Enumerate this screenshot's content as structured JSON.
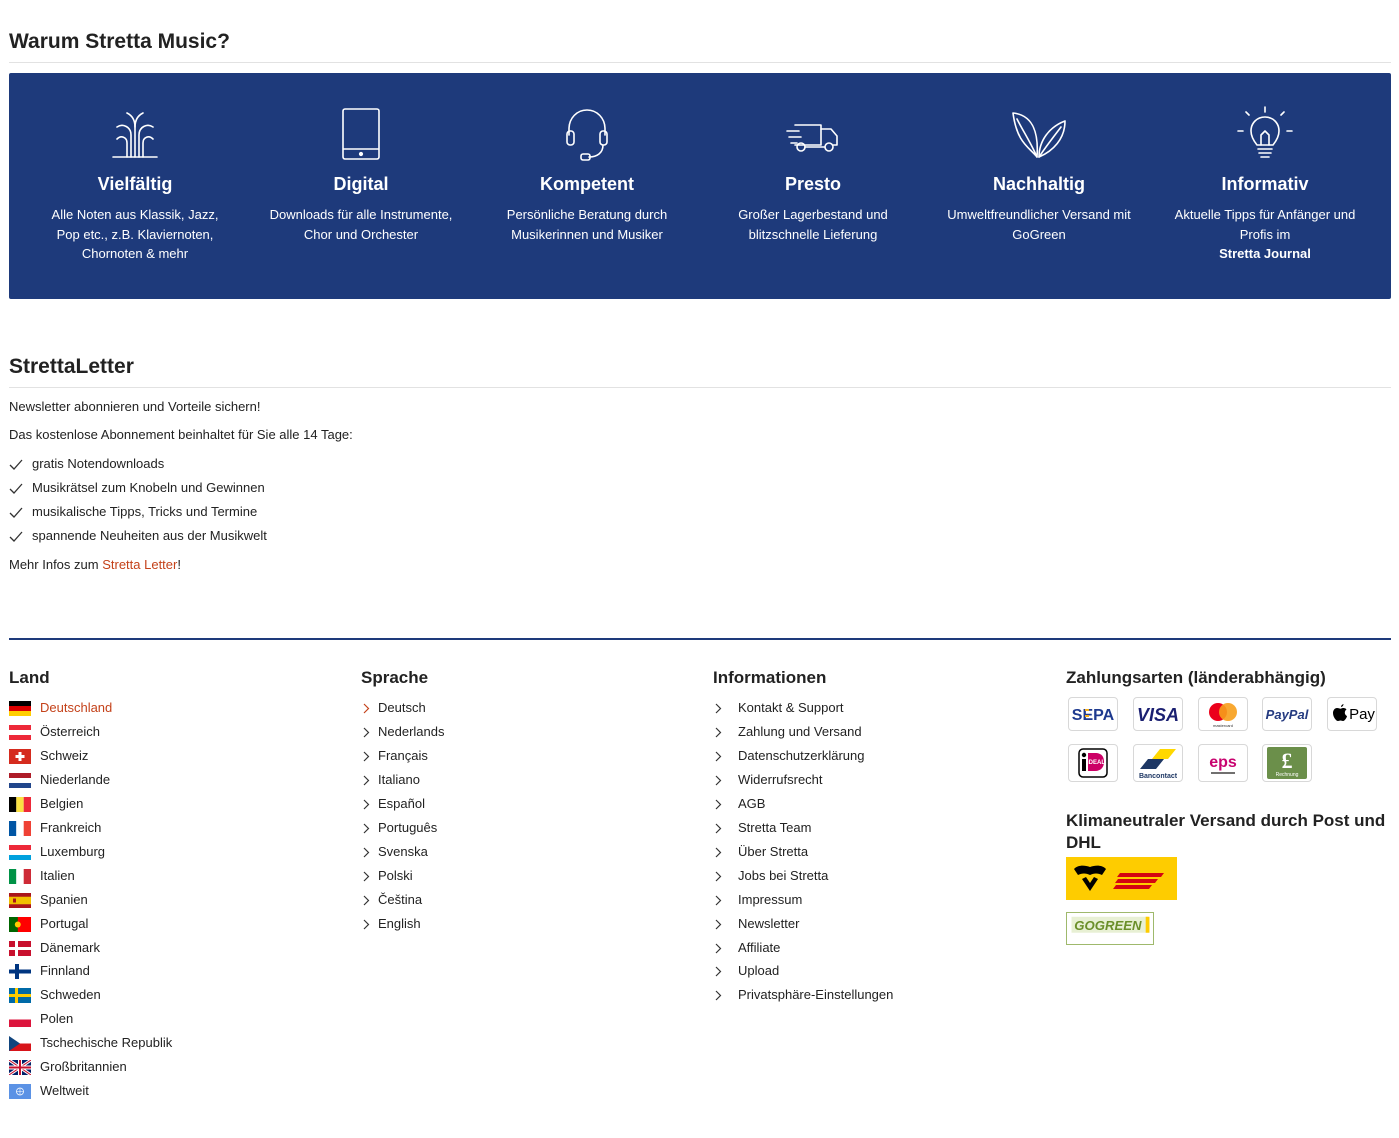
{
  "why": {
    "title": "Warum Stretta Music?",
    "features": [
      {
        "title": "Vielfältig",
        "desc": "Alle Noten aus Klassik, Jazz, Pop etc., z.B. Klaviernoten, Chornoten & mehr",
        "icon": "fountain-icon"
      },
      {
        "title": "Digital",
        "desc": "Downloads für alle Instrumente, Chor und Orchester",
        "icon": "tablet-icon"
      },
      {
        "title": "Kompetent",
        "desc": "Persönliche Beratung durch Musikerinnen und Musiker",
        "icon": "headset-icon"
      },
      {
        "title": "Presto",
        "desc": "Großer Lagerbestand und blitzschnelle Lieferung",
        "icon": "truck-icon"
      },
      {
        "title": "Nachhaltig",
        "desc": "Umweltfreundlicher Versand mit GoGreen",
        "icon": "leaves-icon"
      },
      {
        "title": "Informativ",
        "desc": "Aktuelle Tipps für Anfänger und Profis im",
        "desc_bold": "Stretta Journal",
        "icon": "lightbulb-icon"
      }
    ]
  },
  "newsletter": {
    "title": "StrettaLetter",
    "intro": "Newsletter abonnieren und Vorteile sichern!",
    "sub": "Das kostenlose Abonnement beinhaltet für Sie alle 14 Tage:",
    "benefits": [
      "gratis Notendownloads",
      "Musikrätsel zum Knobeln und Gewinnen",
      "musikalische Tipps, Tricks und Termine",
      "spannende Neuheiten aus der Musikwelt"
    ],
    "more_prefix": "Mehr Infos zum ",
    "more_link": "Stretta Letter",
    "more_suffix": "!"
  },
  "footer": {
    "land": {
      "title": "Land",
      "items": [
        "Deutschland",
        "Österreich",
        "Schweiz",
        "Niederlande",
        "Belgien",
        "Frankreich",
        "Luxemburg",
        "Italien",
        "Spanien",
        "Portugal",
        "Dänemark",
        "Finnland",
        "Schweden",
        "Polen",
        "Tschechische Republik",
        "Großbritannien",
        "Weltweit"
      ]
    },
    "sprache": {
      "title": "Sprache",
      "items": [
        "Deutsch",
        "Nederlands",
        "Français",
        "Italiano",
        "Español",
        "Português",
        "Svenska",
        "Polski",
        "Čeština",
        "English"
      ]
    },
    "info": {
      "title": "Informationen",
      "items": [
        "Kontakt & Support",
        "Zahlung und Versand",
        "Datenschutzerklärung",
        "Widerrufsrecht",
        "AGB",
        "Stretta Team",
        "Über Stretta",
        "Jobs bei Stretta",
        "Impressum",
        "Newsletter",
        "Affiliate",
        "Upload",
        "Privatsphäre-Einstellungen"
      ]
    },
    "payment": {
      "title": "Zahlungsarten (länderabhängig)",
      "sepa": "SEPA",
      "visa": "VISA",
      "mastercard": "mastercard",
      "paypal": "PayPal",
      "applepay": "Pay",
      "ideal": "iDEAL",
      "bancontact": "Bancontact",
      "eps": "eps",
      "rechnung": "Rechnung"
    },
    "shipping": {
      "title": "Klimaneutraler Versand durch Post und DHL",
      "gogreen": "GOGREEN"
    }
  },
  "colors": {
    "brand_blue": "#1e3a7b",
    "accent_orange": "#c4421a",
    "dhl_yellow": "#fecc00",
    "dhl_red": "#d40511"
  }
}
